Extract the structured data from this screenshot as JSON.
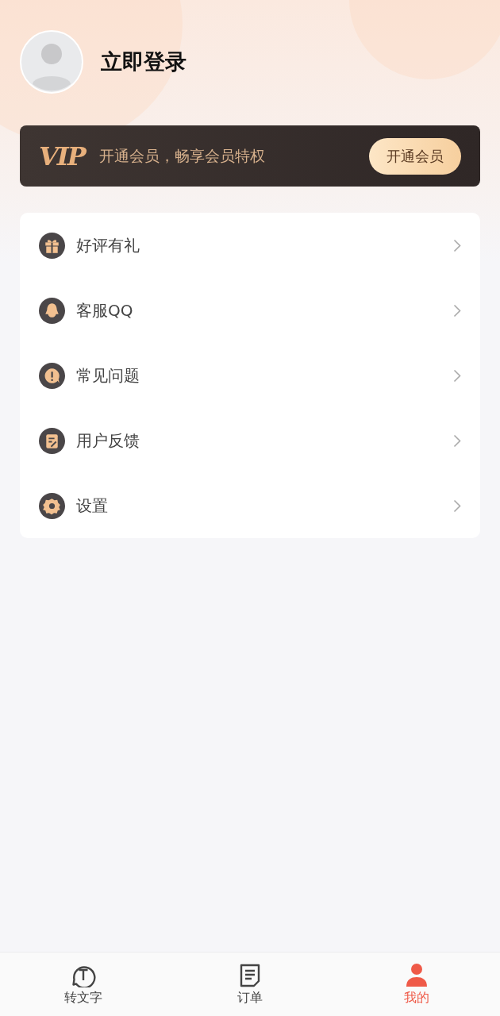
{
  "profile": {
    "title": "立即登录"
  },
  "vip_banner": {
    "logo": "VIP",
    "text": "开通会员，畅享会员特权",
    "button": "开通会员"
  },
  "menu": [
    {
      "kind": "gift",
      "label": "好评有礼"
    },
    {
      "kind": "qq",
      "label": "客服QQ"
    },
    {
      "kind": "faq",
      "label": "常见问题"
    },
    {
      "kind": "feedback",
      "label": "用户反馈"
    },
    {
      "kind": "settings",
      "label": "设置"
    }
  ],
  "tab_bar": [
    {
      "kind": "convert",
      "label": "转文字",
      "selected": false
    },
    {
      "kind": "orders",
      "label": "订单",
      "selected": false
    },
    {
      "kind": "me",
      "label": "我的",
      "selected": true
    }
  ]
}
